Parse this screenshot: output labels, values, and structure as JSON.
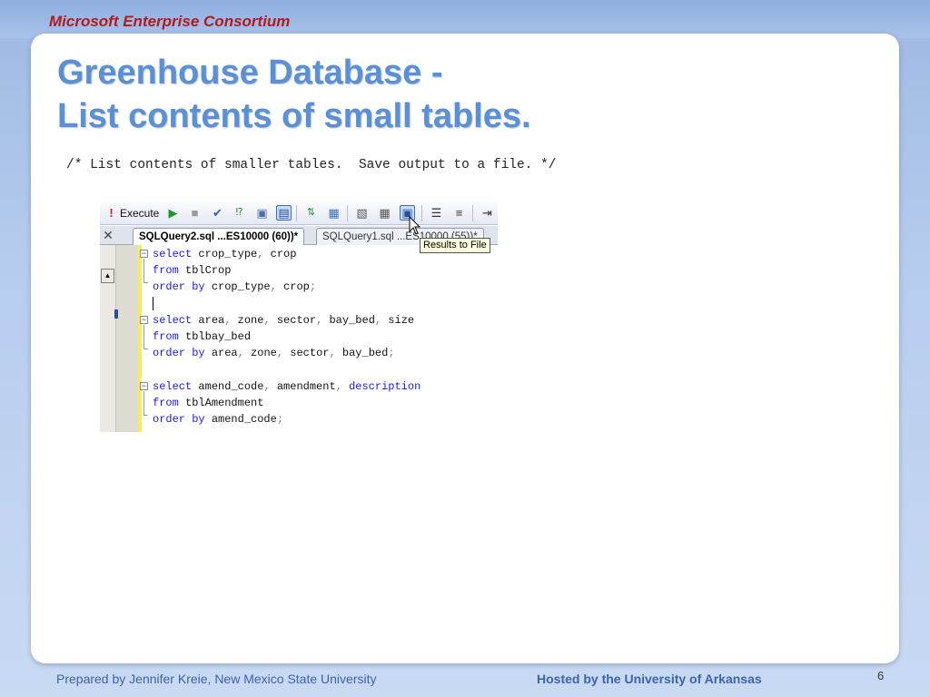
{
  "header": {
    "org": "Microsoft Enterprise Consortium"
  },
  "slide": {
    "title_line1": "Greenhouse Database -",
    "title_line2": "List contents of small tables.",
    "comment": "/* List contents of smaller tables.  Save output to a file. */"
  },
  "editor": {
    "toolbar": {
      "execute_label": "Execute",
      "icons": [
        "execute-icon",
        "play-icon",
        "stop-icon",
        "parse-check-icon",
        "query-options-icon",
        "results-to-text-icon",
        "results-to-grid-icon",
        "results-to-file-icon",
        "comment-icon",
        "uncomment-icon",
        "indent-icon"
      ]
    },
    "tabs": [
      {
        "label": "SQLQuery2.sql ...ES10000 (60))*",
        "active": true
      },
      {
        "label": "SQLQuery1.sql ...ES10000 (55))*",
        "active": false
      }
    ],
    "tooltip": "Results to File",
    "close_glyph": "✕",
    "code_lines": [
      "select crop_type, crop",
      "from tblCrop",
      "order by crop_type, crop;",
      "",
      "select area, zone, sector, bay_bed, size",
      "from tblbay_bed",
      "order by area, zone, sector, bay_bed;",
      "",
      "select amend_code, amendment, description",
      "from tblAmendment",
      "order by amend_code;"
    ]
  },
  "footer": {
    "prepared_by": "Prepared by Jennifer Kreie, New Mexico State University",
    "hosted_by": "Hosted by the University of Arkansas",
    "page_number": "6"
  },
  "colors": {
    "title": "#5b8fd6",
    "org": "#b01c1c",
    "keyword": "#1a1adf",
    "footer": "#3d63a8"
  }
}
